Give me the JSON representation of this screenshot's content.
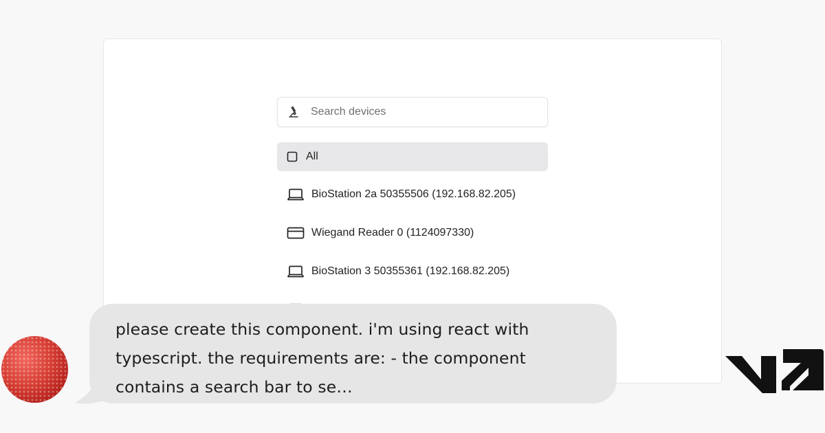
{
  "search": {
    "placeholder": "Search devices"
  },
  "list": {
    "all_label": "All",
    "devices": [
      {
        "label": "BioStation 2a 50355506 (192.168.82.205)",
        "icon": "laptop-icon"
      },
      {
        "label": "Wiegand Reader 0 (1124097330)",
        "icon": "card-icon"
      },
      {
        "label": "BioStation 3 50355361 (192.168.82.205)",
        "icon": "laptop-icon"
      }
    ]
  },
  "message": {
    "text": "please create this component. i'm using react with typescript. the requirements are: - the component contains a search bar to se…"
  },
  "colors": {
    "page_bg": "#f8f8f8",
    "bubble_bg": "#e6e6e6",
    "selected_row": "#e7e7e9",
    "avatar_red": "#d63d33"
  }
}
